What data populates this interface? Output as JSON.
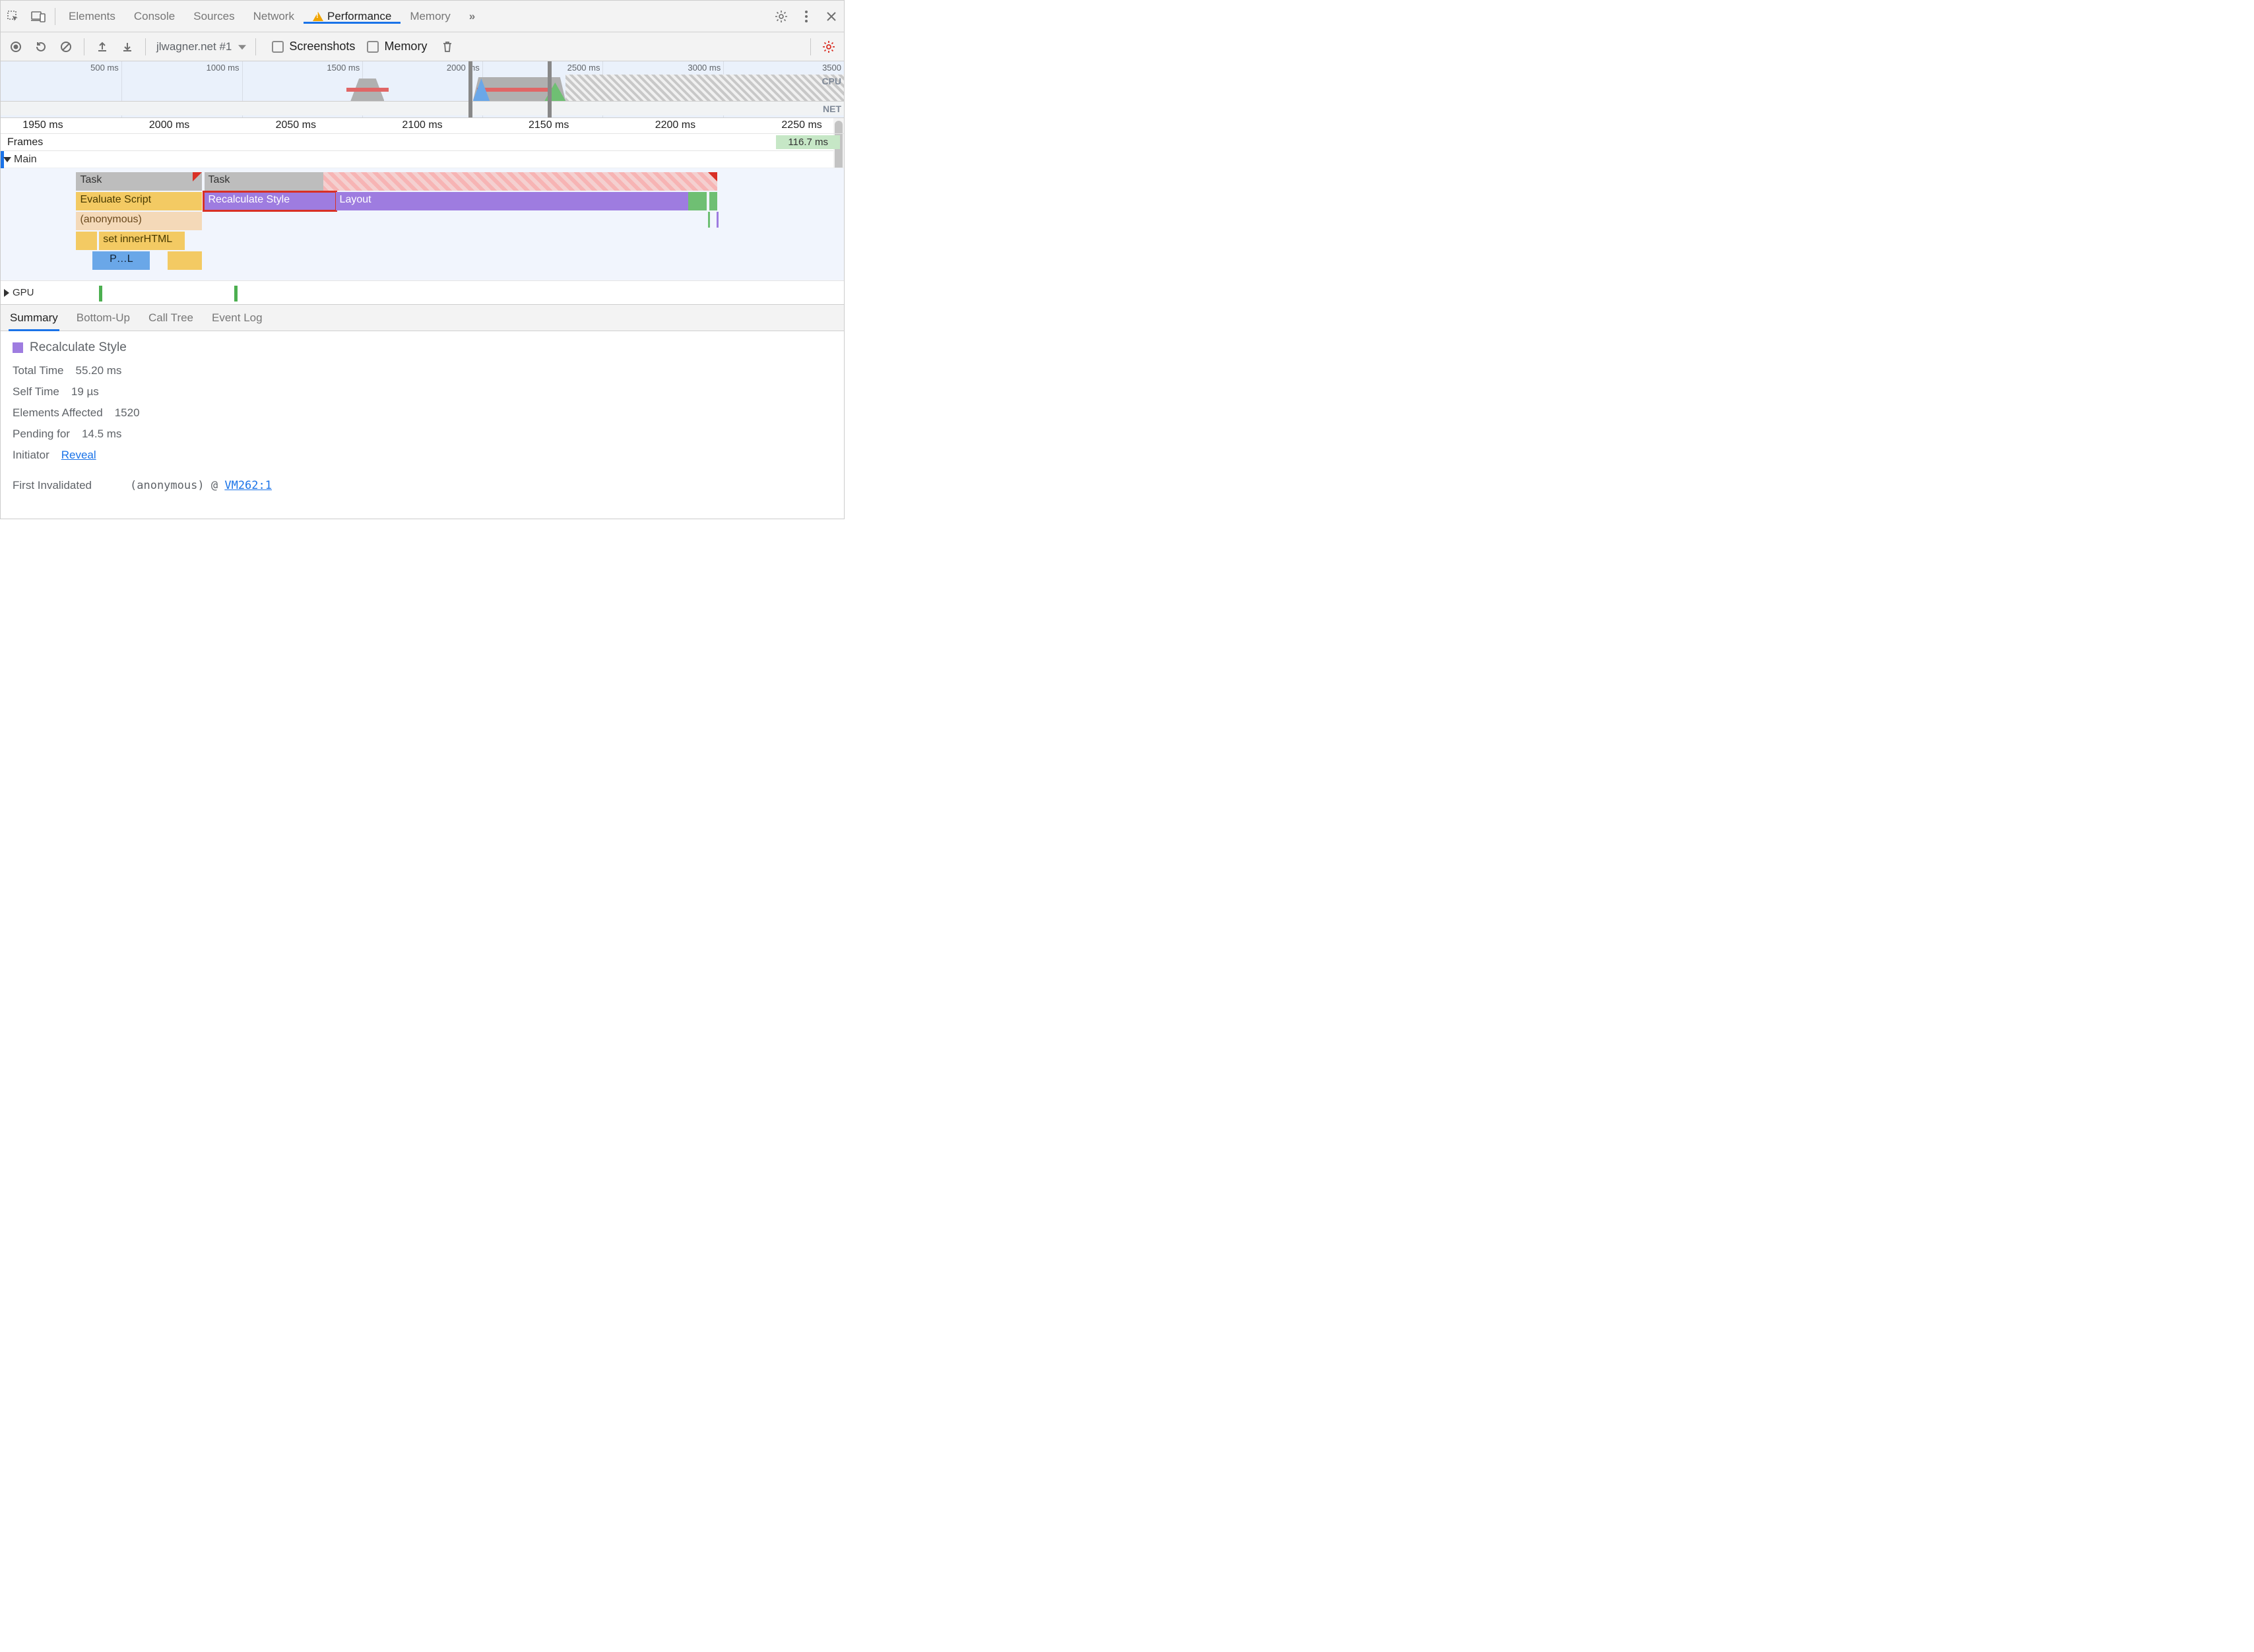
{
  "tabs": {
    "items": [
      "Elements",
      "Console",
      "Sources",
      "Network",
      "Performance",
      "Memory"
    ],
    "active": "Performance",
    "overflow": "»"
  },
  "toolbar": {
    "recording_select": "jlwagner.net #1",
    "cb_screenshots": "Screenshots",
    "cb_memory": "Memory"
  },
  "overview": {
    "ticks": [
      "500 ms",
      "1000 ms",
      "1500 ms",
      "2000 ms",
      "2500 ms",
      "3000 ms",
      "3500"
    ],
    "cpu_label": "CPU",
    "net_label": "NET"
  },
  "detail": {
    "ruler": [
      "1950 ms",
      "2000 ms",
      "2050 ms",
      "2100 ms",
      "2150 ms",
      "2200 ms",
      "2250 ms"
    ],
    "frames_label": "Frames",
    "frame_chip": "116.7 ms",
    "main_label": "Main",
    "gpu_label": "GPU",
    "bars": {
      "task1": "Task",
      "task2": "Task",
      "eval": "Evaluate Script",
      "recalc": "Recalculate Style",
      "layout": "Layout",
      "anon": "(anonymous)",
      "inner": "set innerHTML",
      "blue": "P…L"
    }
  },
  "subtabs": {
    "items": [
      "Summary",
      "Bottom-Up",
      "Call Tree",
      "Event Log"
    ],
    "active": "Summary"
  },
  "summary": {
    "title": "Recalculate Style",
    "rows": {
      "total_time_k": "Total Time",
      "total_time_v": "55.20 ms",
      "self_time_k": "Self Time",
      "self_time_v": "19 µs",
      "elements_k": "Elements Affected",
      "elements_v": "1520",
      "pending_k": "Pending for",
      "pending_v": "14.5 ms",
      "initiator_k": "Initiator",
      "initiator_v": "Reveal",
      "first_inv_k": "First Invalidated",
      "callsite_fn": "(anonymous)",
      "callsite_at": "@",
      "callsite_loc": "VM262:1"
    }
  }
}
